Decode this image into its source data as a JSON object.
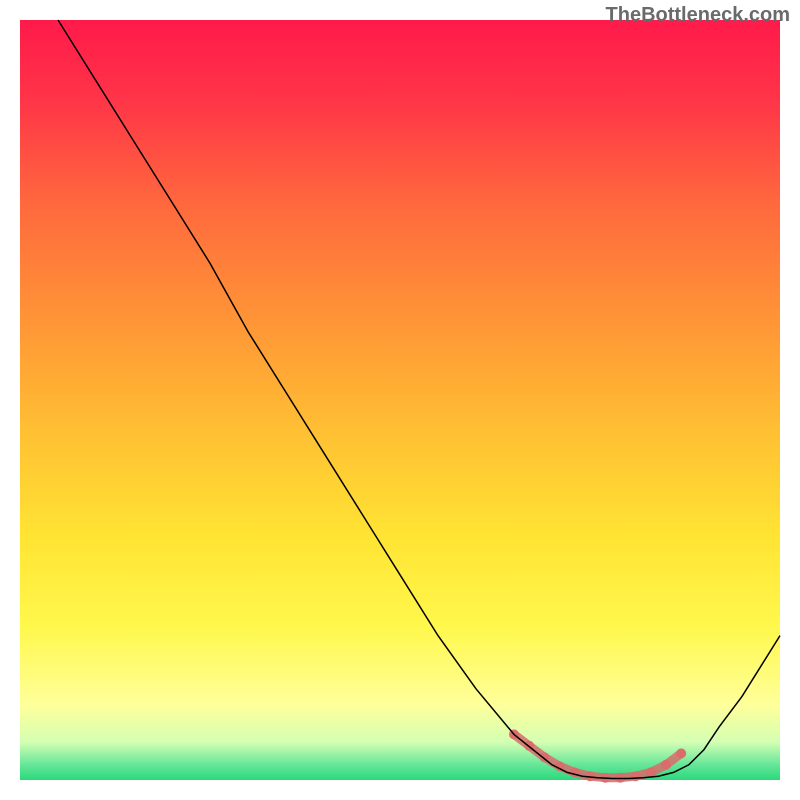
{
  "watermark": "TheBottleneck.com",
  "chart_data": {
    "type": "line",
    "title": "",
    "xlabel": "",
    "ylabel": "",
    "xlim": [
      0,
      100
    ],
    "ylim": [
      0,
      100
    ],
    "series": [
      {
        "name": "curve",
        "color": "#000000",
        "stroke_width": 1.5,
        "x": [
          5,
          10,
          15,
          20,
          25,
          30,
          35,
          40,
          45,
          50,
          55,
          60,
          65,
          70,
          72,
          74,
          76,
          78,
          80,
          82,
          84,
          86,
          88,
          90,
          92,
          95,
          100
        ],
        "y": [
          100,
          92,
          84,
          76,
          68,
          59,
          51,
          43,
          35,
          27,
          19,
          12,
          6,
          2,
          1,
          0.5,
          0.3,
          0.2,
          0.2,
          0.3,
          0.5,
          1,
          2,
          4,
          7,
          11,
          19
        ]
      },
      {
        "name": "highlighted-segment",
        "color": "#d96b6b",
        "stroke_width": 9,
        "x": [
          65,
          67,
          69,
          71,
          73,
          75,
          77,
          79,
          81,
          83,
          85,
          87
        ],
        "y": [
          6,
          4.5,
          3,
          1.8,
          1,
          0.5,
          0.3,
          0.3,
          0.5,
          1,
          2,
          3.5
        ]
      }
    ],
    "background_gradient": {
      "top": "#ff1a4a",
      "mid1": "#ff6b3d",
      "mid2": "#ffb733",
      "mid3": "#ffe433",
      "mid4": "#fffb66",
      "bottom": "#2bd97c",
      "stops": [
        0,
        25,
        50,
        70,
        85,
        100
      ]
    }
  }
}
